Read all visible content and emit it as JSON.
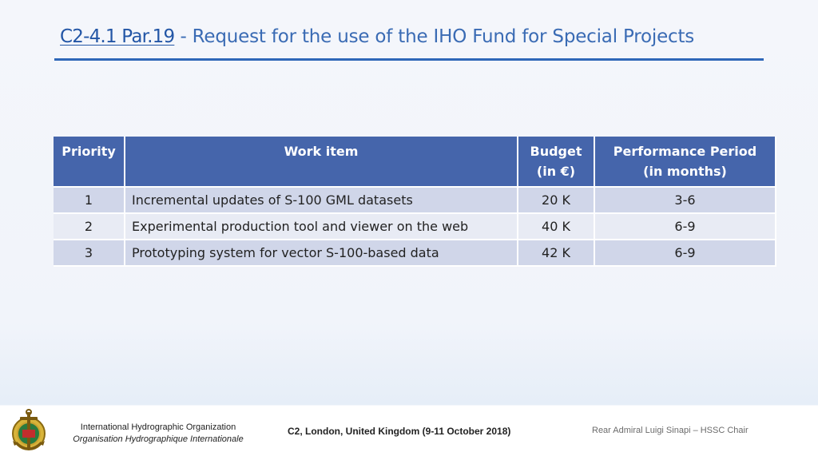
{
  "title": {
    "code": "C2-4.1 Par.19",
    "separator": " - ",
    "text": "Request for the use of the IHO Fund for Special Projects"
  },
  "table": {
    "headers": {
      "priority": "Priority",
      "work_item": "Work item",
      "budget_line1": "Budget",
      "budget_line2": "(in €)",
      "period_line1": "Performance Period",
      "period_line2": "(in months)"
    },
    "rows": [
      {
        "priority": "1",
        "work_item": "Incremental updates of S-100 GML datasets",
        "budget": "20 K",
        "period": "3-6"
      },
      {
        "priority": "2",
        "work_item": "Experimental production tool and viewer on the web",
        "budget": "40 K",
        "period": "6-9"
      },
      {
        "priority": "3",
        "work_item": "Prototyping system for vector S-100-based data",
        "budget": "42 K",
        "period": "6-9"
      }
    ]
  },
  "footer": {
    "logo_icon": "iho-anchor-emblem-icon",
    "org_en": "International Hydrographic Organization",
    "org_fr": "Organisation Hydrographique Internationale",
    "event": "C2, London, United Kingdom (9-11 October 2018)",
    "chair": "Rear Admiral Luigi Sinapi – HSSC Chair"
  },
  "colors": {
    "title": "#3a6bb4",
    "rule": "#2e67b8",
    "header_bg": "#4565ab",
    "row_odd": "#d0d6e9",
    "row_even": "#e8ebf4"
  }
}
